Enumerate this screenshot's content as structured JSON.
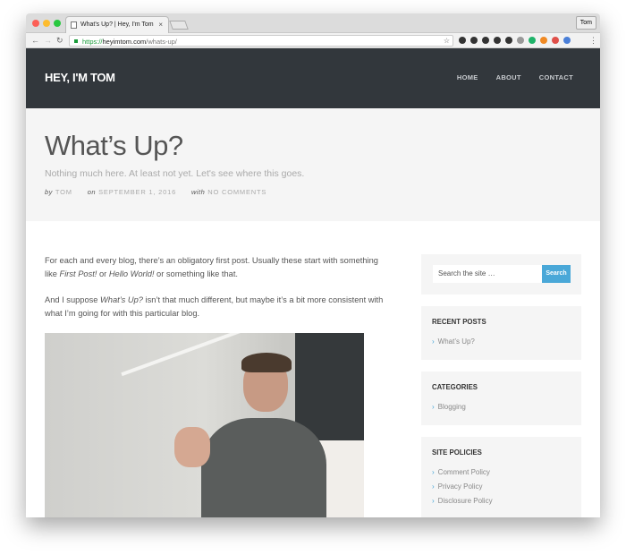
{
  "browser": {
    "tab_title": "What's Up? | Hey, I'm Tom",
    "tab_close": "×",
    "profile": "Tom",
    "url_scheme": "https://",
    "url_host": "heyimtom.com",
    "url_path": "/whats-up/",
    "extension_colors": [
      "#333",
      "#333",
      "#333",
      "#333",
      "#333",
      "#999",
      "#1fb36a",
      "#f08a24",
      "#e0504a",
      "#4a7fd8"
    ]
  },
  "site": {
    "logo": "HEY, I'M TOM",
    "menu": [
      "HOME",
      "ABOUT",
      "CONTACT"
    ]
  },
  "hero": {
    "title": "What’s Up?",
    "subtitle": "Nothing much here. At least not yet. Let's see where this goes.",
    "meta": {
      "by_label": "by",
      "author": "TOM",
      "on_label": "on",
      "date": "SEPTEMBER 1, 2016",
      "with_label": "with",
      "comments": "NO COMMENTS"
    }
  },
  "post": {
    "p1_a": "For each and every blog, there’s an obligatory first post. Usually these start with something like ",
    "p1_em1": "First Post!",
    "p1_b": " or ",
    "p1_em2": "Hello World!",
    "p1_c": " or something like that.",
    "p2_a": "And I suppose ",
    "p2_em": "What’s Up?",
    "p2_b": " isn’t that much different, but maybe it’s a bit more consistent with what I’m going for with this particular blog."
  },
  "sidebar": {
    "search_placeholder": "Search the site …",
    "search_button": "Search",
    "widgets": [
      {
        "title": "RECENT POSTS",
        "items": [
          "What’s Up?"
        ]
      },
      {
        "title": "CATEGORIES",
        "items": [
          "Blogging"
        ]
      },
      {
        "title": "SITE POLICIES",
        "items": [
          "Comment Policy",
          "Privacy Policy",
          "Disclosure Policy"
        ]
      }
    ]
  }
}
